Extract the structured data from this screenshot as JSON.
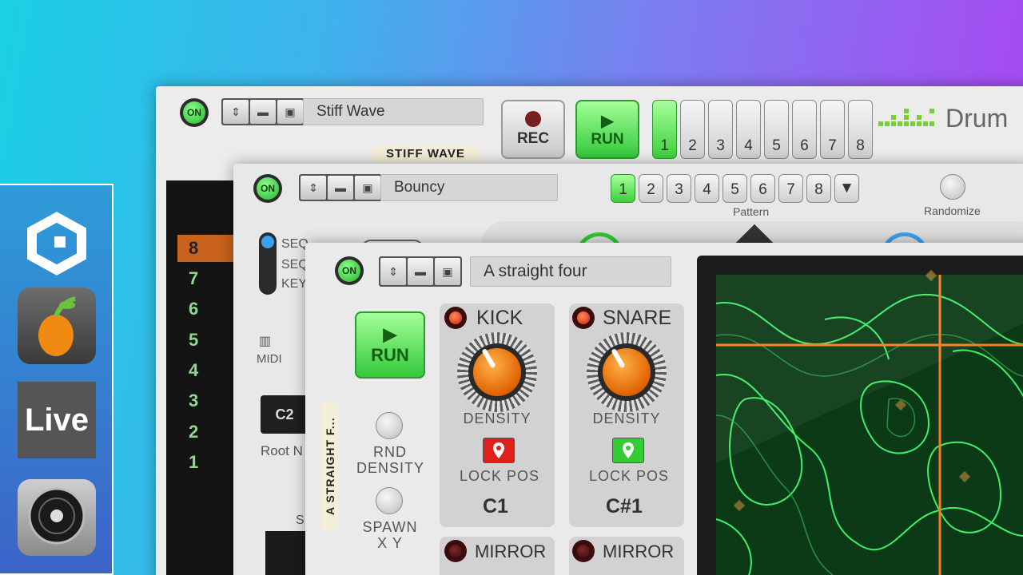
{
  "dock": {
    "apps": [
      {
        "icon": "reason-icon"
      },
      {
        "icon": "fl-studio-icon"
      },
      {
        "label": "Live",
        "icon": "ableton-live-icon"
      },
      {
        "icon": "logic-pro-icon"
      }
    ]
  },
  "panel_back": {
    "on_label": "ON",
    "patch_name": "Stiff Wave",
    "rec_label": "REC",
    "run_label": "RUN",
    "patterns": [
      "1",
      "2",
      "3",
      "4",
      "5",
      "6",
      "7",
      "8"
    ],
    "active_pattern": "1",
    "device_name": "Drum",
    "tape_label": "STIFF WAVE",
    "sequence_numbers": [
      "8",
      "7",
      "6",
      "5",
      "4",
      "3",
      "2",
      "1"
    ]
  },
  "panel_mid": {
    "on_label": "ON",
    "patch_name": "Bouncy",
    "patterns": [
      "1",
      "2",
      "3",
      "4",
      "5",
      "6",
      "7",
      "8"
    ],
    "active_pattern": "1",
    "pattern_label": "Pattern",
    "randomize_label": "Randomize",
    "mode_options": [
      "SEQ",
      "SEQ",
      "KEY"
    ],
    "midi_label": "MIDI",
    "root_note_value": "C2",
    "root_note_label": "Root N",
    "s_label": "S"
  },
  "panel_front": {
    "on_label": "ON",
    "patch_name": "A straight four",
    "run_label": "RUN",
    "tape_label": "A STRAIGHT F...",
    "rnd_density_label": "RND\nDENSITY",
    "spawn_label": "SPAWN\nX Y",
    "tracks": [
      {
        "name": "KICK",
        "knob_label": "DENSITY",
        "lock_label": "LOCK POS",
        "note": "C1",
        "mirror_label": "MIRROR",
        "lock_color": "#e0201a"
      },
      {
        "name": "SNARE",
        "knob_label": "DENSITY",
        "lock_label": "LOCK POS",
        "note": "C#1",
        "mirror_label": "MIRROR",
        "lock_color": "#33cc33"
      }
    ]
  },
  "colors": {
    "accent_green": "#34c83a",
    "knob_orange": "#e06300",
    "screen_contour": "#3df06a",
    "crosshair": "#ff7a1a"
  }
}
